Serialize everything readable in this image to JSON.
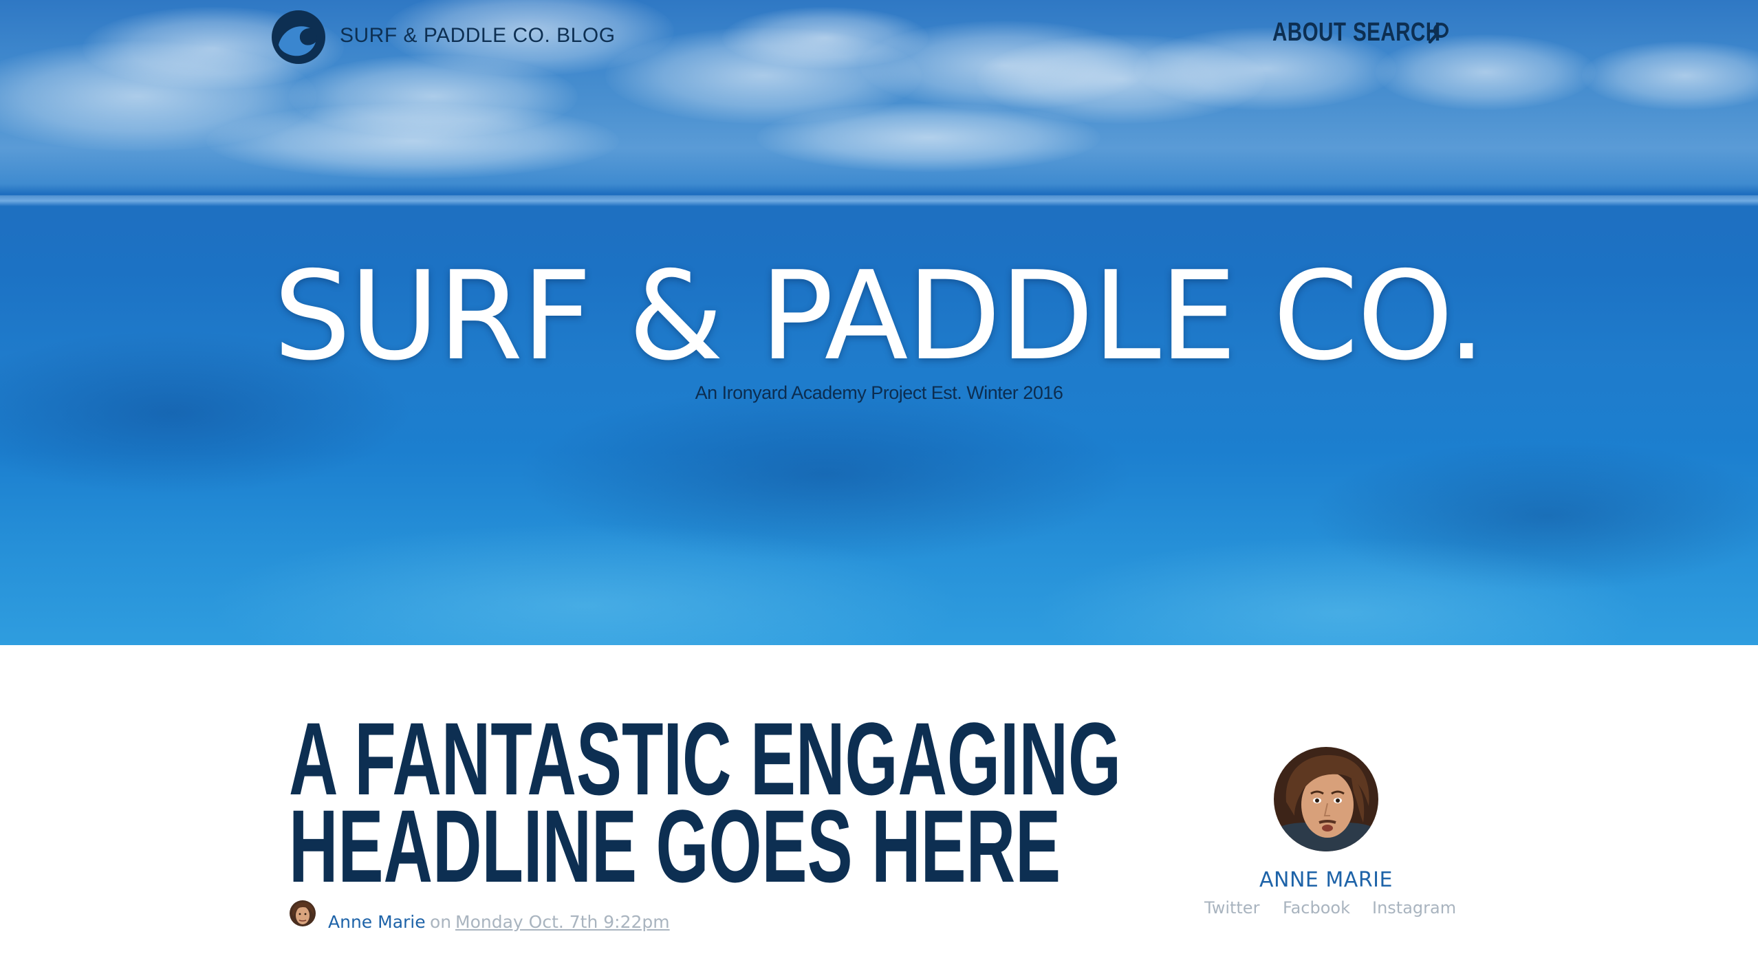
{
  "nav": {
    "blog_name": "SURF & PADDLE CO. BLOG",
    "about": "ABOUT",
    "search": "SEARCH"
  },
  "hero": {
    "title": "SURF & PADDLE CO.",
    "subtitle": "An Ironyard Academy Project Est. Winter 2016"
  },
  "article": {
    "headline_lines": [
      "A FANTASTIC ENGAGING",
      "HEADLINE GOES HERE"
    ],
    "author": "Anne Marie",
    "on": "on",
    "date": "Monday Oct. 7th 9:22pm"
  },
  "author_card": {
    "name": "ANNE MARIE",
    "links": [
      "Twitter",
      "Facbook",
      "Instagram"
    ]
  },
  "colors": {
    "navy": "#0d2f52",
    "link_blue": "#1e63a8",
    "muted_gray": "#a9b4bf",
    "ocean_blue": "#1c72c4"
  },
  "icons": {
    "logo": "wave-logo-icon",
    "search": "magnifier-icon"
  }
}
